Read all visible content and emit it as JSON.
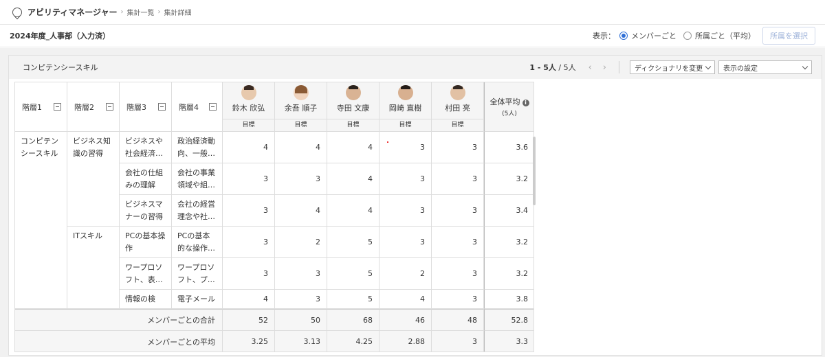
{
  "header": {
    "app_title": "アビリティマネージャー",
    "breadcrumbs": [
      "集計一覧",
      "集計詳細"
    ]
  },
  "subbar": {
    "title": "2024年度_人事部（入力済）",
    "display_label": "表示：",
    "radio_member": "メンバーごと",
    "radio_org": "所属ごと（平均）",
    "select_button": "所属を選択"
  },
  "panel": {
    "title": "コンピテンシースキル",
    "pager_range": "1 - 5人",
    "pager_total": " / 5人",
    "dictionary_select": "ディクショナリを変更",
    "display_settings": "表示の設定"
  },
  "columns": {
    "h1": "階層1",
    "h2": "階層2",
    "h3": "階層3",
    "h4": "階層4",
    "avg_label": "全体平均",
    "avg_sub": "(5人)",
    "goal": "目標"
  },
  "members": [
    {
      "name": "鈴木 欣弘",
      "goal": "目標"
    },
    {
      "name": "余吾 順子",
      "goal": "目標"
    },
    {
      "name": "寺田 文康",
      "goal": "目標"
    },
    {
      "name": "岡崎 直樹",
      "goal": "目標"
    },
    {
      "name": "村田 亮",
      "goal": "目標"
    }
  ],
  "groups": {
    "l1": "コンピテンシースキル",
    "l2a": "ビジネス知識の習得",
    "l2b": "ITスキル"
  },
  "rows": [
    {
      "l3": "ビジネスや社会経済…",
      "l4": "政治経済動向、一般…",
      "v": [
        "4",
        "4",
        "4",
        "3",
        "3"
      ],
      "avg": "3.6"
    },
    {
      "l3": "会社の仕組みの理解",
      "l4": "会社の事業領域や組…",
      "v": [
        "3",
        "3",
        "4",
        "3",
        "3"
      ],
      "avg": "3.2"
    },
    {
      "l3": "ビジネスマナーの習得",
      "l4": "会社の経営理念や社…",
      "v": [
        "3",
        "4",
        "4",
        "3",
        "3"
      ],
      "avg": "3.4"
    },
    {
      "l3": "PCの基本操作",
      "l4": "PCの基本的な操作…",
      "v": [
        "3",
        "2",
        "5",
        "3",
        "3"
      ],
      "avg": "3.2"
    },
    {
      "l3": "ワープロソフト、表…",
      "l4": "ワープロソフト、プ…",
      "v": [
        "3",
        "3",
        "5",
        "2",
        "3"
      ],
      "avg": "3.2"
    },
    {
      "l3": "情報の検",
      "l4": "電子メール",
      "v": [
        "4",
        "3",
        "5",
        "4",
        "3"
      ],
      "avg": "3.8"
    }
  ],
  "footer": {
    "sum_label": "メンバーごとの合計",
    "sum": [
      "52",
      "50",
      "68",
      "46",
      "48"
    ],
    "sum_avg": "52.8",
    "avg_label": "メンバーごとの平均",
    "avg": [
      "3.25",
      "3.13",
      "4.25",
      "2.88",
      "3"
    ],
    "avg_avg": "3.3"
  }
}
